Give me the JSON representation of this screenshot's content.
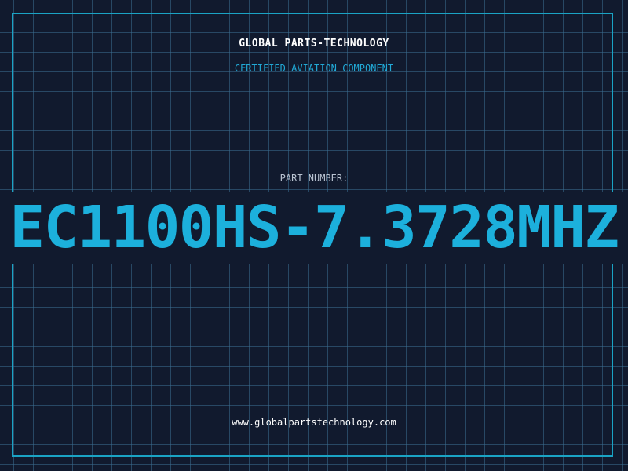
{
  "header": {
    "brand": "GLOBAL PARTS-TECHNOLOGY",
    "tagline": "CERTIFIED AVIATION COMPONENT"
  },
  "part": {
    "label": "PART NUMBER:",
    "value": "EC1100HS-7.3728MHZ"
  },
  "footer": {
    "website": "www.globalpartstechnology.com"
  },
  "colors": {
    "background": "#111a2e",
    "grid": "#3a6e91",
    "accent": "#1cb0dc",
    "frame": "#1aa3c4",
    "label": "#b9c3d1",
    "text": "#ffffff"
  }
}
